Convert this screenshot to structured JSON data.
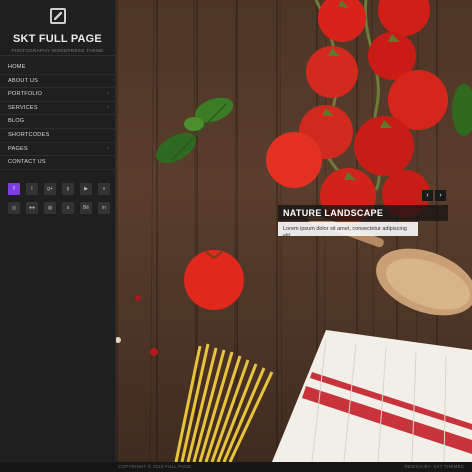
{
  "site": {
    "title": "SKT FULL PAGE",
    "tagline": "PHOTOGRAPHY WORDPRESS THEME"
  },
  "nav": {
    "items": [
      {
        "label": "HOME",
        "has_submenu": false
      },
      {
        "label": "ABOUT US",
        "has_submenu": false
      },
      {
        "label": "PORTFOLIO",
        "has_submenu": true
      },
      {
        "label": "SERVICES",
        "has_submenu": true
      },
      {
        "label": "BLOG",
        "has_submenu": false
      },
      {
        "label": "SHORTCODES",
        "has_submenu": false
      },
      {
        "label": "PAGES",
        "has_submenu": true
      },
      {
        "label": "CONTACT US",
        "has_submenu": false
      }
    ],
    "submenu_arrow": "›"
  },
  "social": {
    "row1": [
      {
        "icon": "facebook-icon",
        "glyph": "f",
        "active": true
      },
      {
        "icon": "twitter-icon",
        "glyph": "t"
      },
      {
        "icon": "google-plus-icon",
        "glyph": "g+"
      },
      {
        "icon": "pinterest-icon",
        "glyph": "p"
      },
      {
        "icon": "youtube-icon",
        "glyph": "▶"
      },
      {
        "icon": "vimeo-icon",
        "glyph": "v"
      }
    ],
    "row2": [
      {
        "icon": "instagram-icon",
        "glyph": "◎"
      },
      {
        "icon": "flickr-icon",
        "glyph": "●●"
      },
      {
        "icon": "dribbble-icon",
        "glyph": "◍"
      },
      {
        "icon": "skype-icon",
        "glyph": "s"
      },
      {
        "icon": "behance-icon",
        "glyph": "Bē"
      },
      {
        "icon": "linkedin-icon",
        "glyph": "in"
      }
    ],
    "active_color": "#7b3fe4"
  },
  "slider": {
    "title": "NATURE LANDSCAPE",
    "text": "Lorem ipsum dolor sit amet, consectetur adipiscing elit.",
    "prev": "‹",
    "next": "›"
  },
  "footer": {
    "copyright": "COPYRIGHT © 2018 FULL PAGE",
    "credit": "DESIGN BY: SKT THEMES"
  }
}
